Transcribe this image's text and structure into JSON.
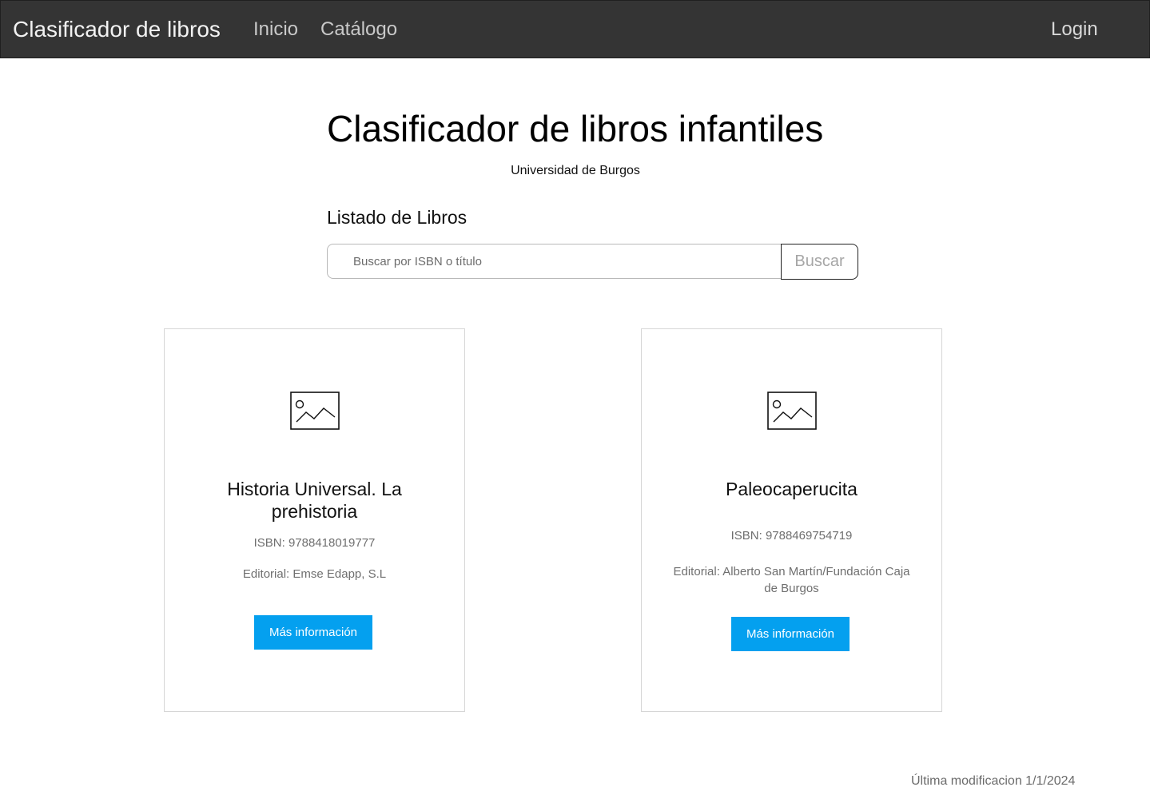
{
  "navbar": {
    "brand": "Clasificador de libros",
    "links": [
      {
        "label": "Inicio"
      },
      {
        "label": "Catálogo"
      }
    ],
    "login": "Login"
  },
  "header": {
    "title": "Clasificador de libros infantiles",
    "subtitle": "Universidad de Burgos"
  },
  "listing": {
    "title": "Listado de Libros",
    "search": {
      "placeholder": "Buscar por ISBN o título",
      "value": "",
      "button_label": "Buscar"
    }
  },
  "books": [
    {
      "title": "Historia Universal. La prehistoria",
      "isbn": "ISBN: 9788418019777",
      "editorial": "Editorial: Emse Edapp, S.L",
      "button_label": "Más información",
      "image_icon": "image-placeholder-icon"
    },
    {
      "title": "Paleocaperucita",
      "isbn": "ISBN: 9788469754719",
      "editorial": "Editorial: Alberto San Martín/Fundación Caja de Burgos",
      "button_label": "Más información",
      "image_icon": "image-placeholder-icon"
    }
  ],
  "footer": {
    "last_modified": "Última modificacion 1/1/2024"
  },
  "colors": {
    "navbar_bg": "#343434",
    "primary_button": "#04a0ef"
  }
}
